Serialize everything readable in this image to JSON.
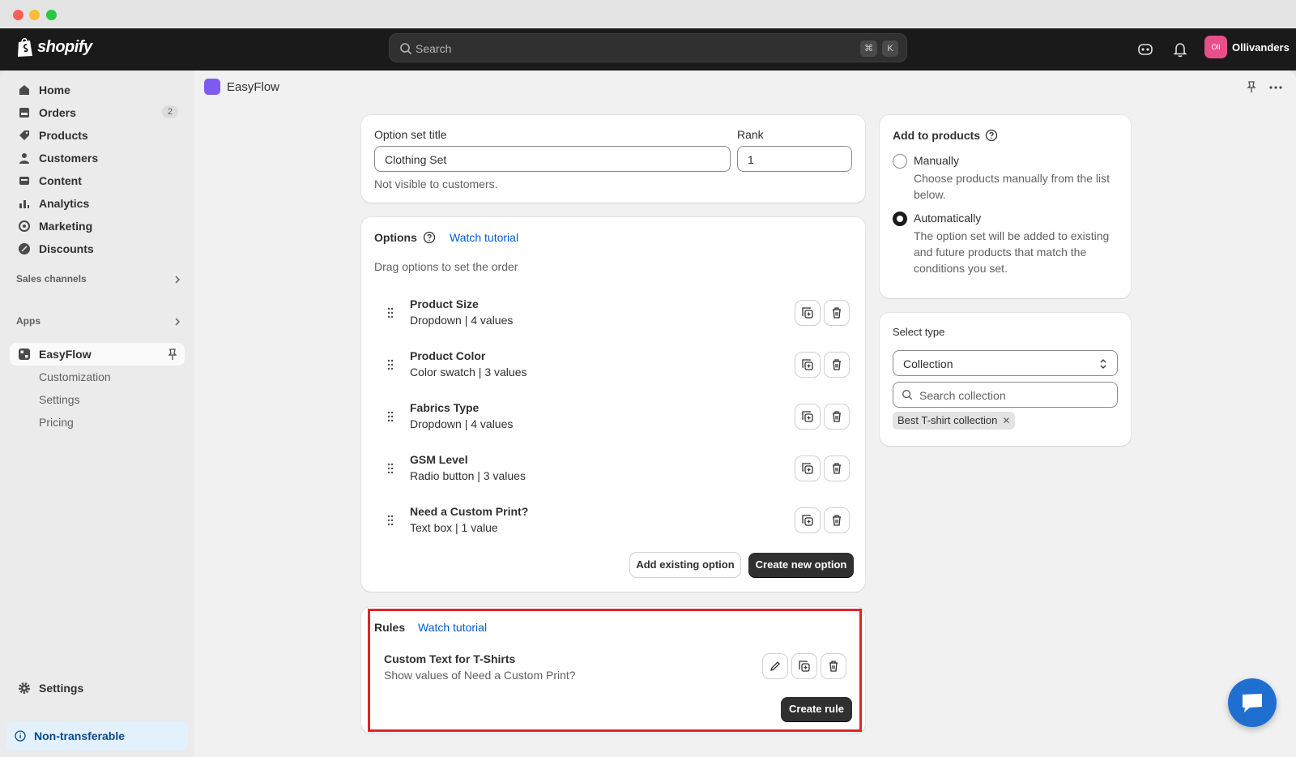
{
  "topbar": {
    "brand": "shopify",
    "search_placeholder": "Search",
    "shortcut_cmd": "⌘",
    "shortcut_key": "K",
    "store_initials": "Oll",
    "store_name": "Ollivanders"
  },
  "sidebar": {
    "items": [
      {
        "label": "Home",
        "icon": "home-icon"
      },
      {
        "label": "Orders",
        "icon": "orders-icon",
        "badge": "2"
      },
      {
        "label": "Products",
        "icon": "tag-icon"
      },
      {
        "label": "Customers",
        "icon": "person-icon"
      },
      {
        "label": "Content",
        "icon": "content-icon"
      },
      {
        "label": "Analytics",
        "icon": "analytics-icon"
      },
      {
        "label": "Marketing",
        "icon": "marketing-icon"
      },
      {
        "label": "Discounts",
        "icon": "discount-icon"
      }
    ],
    "sales_channels": "Sales channels",
    "apps": "Apps",
    "app_name": "EasyFlow",
    "app_subitems": [
      "Customization",
      "Settings",
      "Pricing"
    ],
    "settings": "Settings",
    "non_transferable": "Non-transferable"
  },
  "header": {
    "app_title": "EasyFlow"
  },
  "option_set": {
    "title_label": "Option set title",
    "title_value": "Clothing Set",
    "rank_label": "Rank",
    "rank_value": "1",
    "help": "Not visible to customers."
  },
  "options": {
    "title": "Options",
    "watch_tutorial": "Watch tutorial",
    "subtitle": "Drag options to set the order",
    "items": [
      {
        "name": "Product Size",
        "desc": "Dropdown | 4 values"
      },
      {
        "name": "Product Color",
        "desc": "Color swatch | 3 values"
      },
      {
        "name": "Fabrics Type",
        "desc": "Dropdown | 4 values"
      },
      {
        "name": "GSM Level",
        "desc": "Radio button | 3 values"
      },
      {
        "name": "Need a Custom Print?",
        "desc": "Text box | 1 value"
      }
    ],
    "add_existing": "Add existing option",
    "create_new": "Create new option"
  },
  "rules": {
    "title": "Rules",
    "watch_tutorial": "Watch tutorial",
    "rule_name": "Custom Text for T-Shirts",
    "rule_desc": "Show values of Need a Custom Print?",
    "create_rule": "Create rule"
  },
  "add_to_products": {
    "title": "Add to products",
    "manual_label": "Manually",
    "manual_help": "Choose products manually from the list below.",
    "auto_label": "Automatically",
    "auto_help": "The option set will be added to existing and future products that match the conditions you set.",
    "selected": "Automatically"
  },
  "select_type": {
    "label": "Select type",
    "value": "Collection",
    "search_placeholder": "Search collection",
    "tag": "Best T-shirt collection"
  },
  "colors": {
    "topbar": "#1a1a1a",
    "primary_button": "#303030",
    "link": "#005bd3",
    "highlight": "#e02424",
    "chat": "#1f6fd1"
  }
}
